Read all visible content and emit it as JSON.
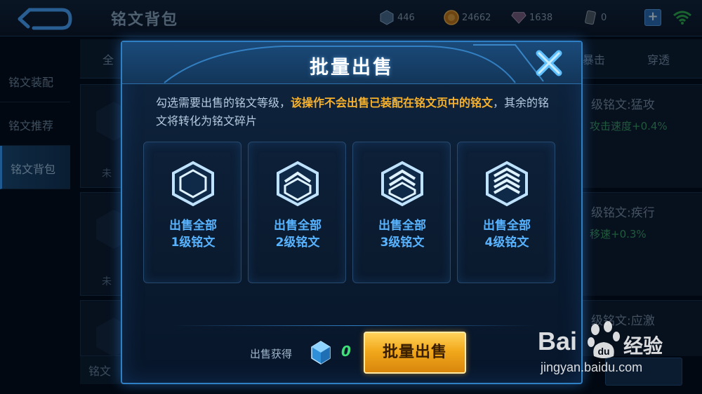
{
  "topbar": {
    "title": "铭文背包",
    "resources": [
      {
        "icon": "gem-icon",
        "value": "446"
      },
      {
        "icon": "gold-coin-icon",
        "value": "24662"
      },
      {
        "icon": "diamond-icon",
        "value": "1638"
      },
      {
        "icon": "card-icon",
        "value": "0"
      }
    ],
    "plus_label": "+"
  },
  "sidebar": {
    "items": [
      {
        "label": "铭文装配"
      },
      {
        "label": "铭文推荐"
      },
      {
        "label": "铭文背包"
      }
    ]
  },
  "background": {
    "tabs": [
      "全",
      "暴击",
      "穿透"
    ],
    "card_labels": [
      "未",
      "未"
    ],
    "right_items": [
      {
        "title": "级铭文:猛攻",
        "stat": "攻击速度+0.4%"
      },
      {
        "title": "级铭文:疾行",
        "stat": "移速+0.3%"
      },
      {
        "title": "级铭文:应激",
        "stat": ""
      }
    ],
    "bottom_label": "铭文"
  },
  "modal": {
    "title": "批量出售",
    "desc_normal_1": "勾选需要出售的铭文等级，",
    "desc_warn": "该操作不会出售已装配在铭文页中的铭文",
    "desc_normal_2": "，其余的铭文将转化为铭文碎片",
    "levels": [
      {
        "line1": "出售全部",
        "line2": "1级铭文",
        "icon": "rune-level-1-icon"
      },
      {
        "line1": "出售全部",
        "line2": "2级铭文",
        "icon": "rune-level-2-icon"
      },
      {
        "line1": "出售全部",
        "line2": "3级铭文",
        "icon": "rune-level-3-icon"
      },
      {
        "line1": "出售全部",
        "line2": "4级铭文",
        "icon": "rune-level-4-icon"
      }
    ],
    "earn_label": "出售获得",
    "earn_value": "0",
    "sell_button": "批量出售"
  },
  "watermark": {
    "brand": "Bai",
    "brand2": "经验",
    "url": "jingyan.baidu.com"
  },
  "colors": {
    "accent": "#2f7fc4",
    "warning_text": "#f7b12a",
    "level_text": "#58b3ff",
    "earn_value": "#3fe07a",
    "button_gold": "#f2a91c"
  }
}
